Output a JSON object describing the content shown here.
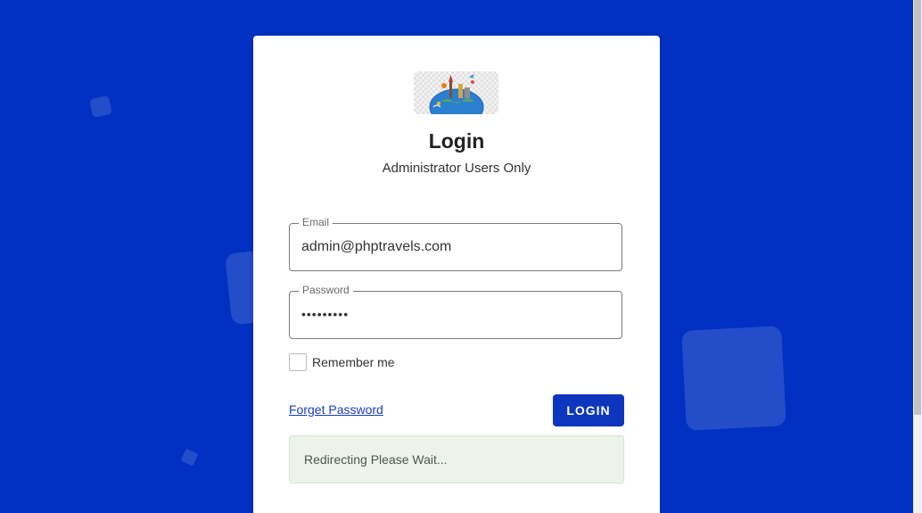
{
  "login": {
    "title": "Login",
    "subtitle": "Administrator Users Only",
    "email": {
      "label": "Email",
      "value": "admin@phptravels.com"
    },
    "password": {
      "label": "Password",
      "value": "•••••••••"
    },
    "remember_label": "Remember me",
    "remember_checked": false,
    "forget_label": "Forget Password",
    "login_button_label": "LOGIN",
    "status_message": "Redirecting Please Wait..."
  },
  "colors": {
    "background": "#0130c2",
    "primary_button": "#0d35be",
    "link": "#1a3dc1",
    "alert_background": "#edf3ea"
  },
  "icons": {
    "logo": "travel-globe-logo-icon"
  }
}
